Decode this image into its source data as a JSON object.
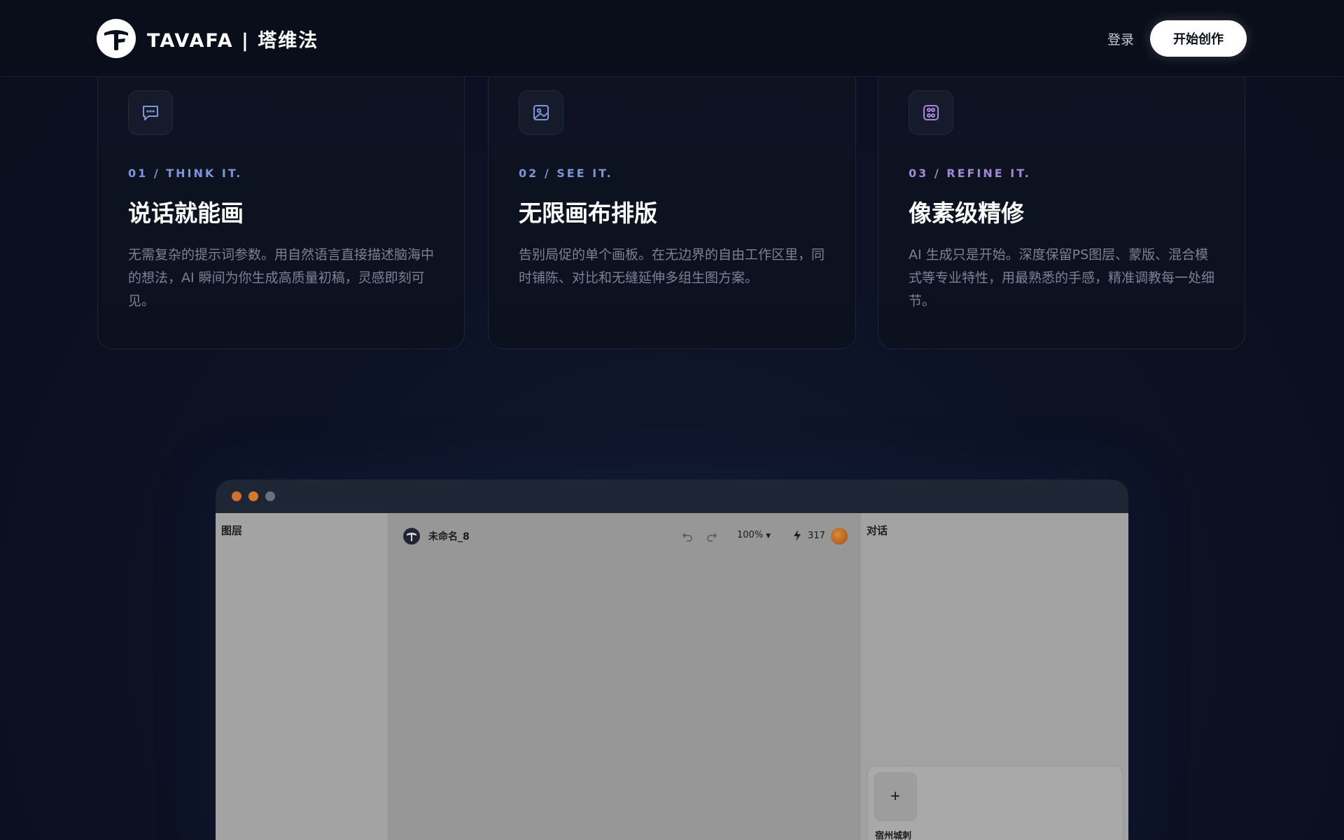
{
  "header": {
    "brand": "TAVAFA | 塔维法",
    "login_label": "登录",
    "cta_label": "开始创作"
  },
  "features": [
    {
      "icon": "chat-bubble-icon",
      "step": "01 / THINK IT.",
      "step_color": "#7f95d8",
      "title": "说话就能画",
      "description": "无需复杂的提示词参数。用自然语言直接描述脑海中的想法，AI 瞬间为你生成高质量初稿，灵感即刻可见。"
    },
    {
      "icon": "image-icon",
      "step": "02 / SEE IT.",
      "step_color": "#7f95d8",
      "title": "无限画布排版",
      "description": "告别局促的单个画板。在无边界的自由工作区里，同时铺陈、对比和无缝延伸多组生图方案。"
    },
    {
      "icon": "layers-adjust-icon",
      "step": "03 / REFINE IT.",
      "step_color": "#a487d6",
      "title": "像素级精修",
      "description": "AI 生成只是开始。深度保留PS图层、蒙版、混合模式等专业特性，用最熟悉的手感，精准调教每一处细节。"
    }
  ],
  "preview": {
    "layers_title": "图层",
    "doc_name": "未命名_8",
    "zoom": "100%",
    "credits": "317",
    "chat_title": "对话",
    "chip_label": "宿州城刺",
    "add_symbol": "+"
  }
}
